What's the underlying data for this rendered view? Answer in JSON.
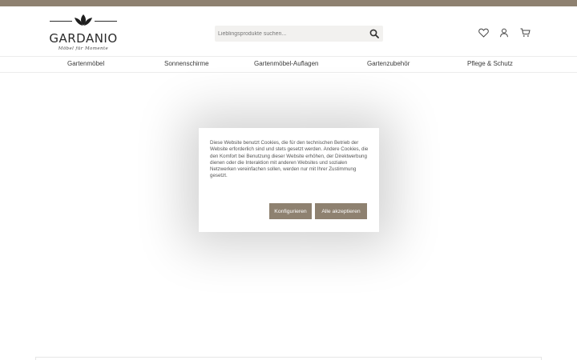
{
  "brand": {
    "name": "GARDANIO",
    "tagline": "Möbel für Momente",
    "accent_color": "#8e8170"
  },
  "search": {
    "placeholder": "Lieblingsprodukte suchen...",
    "icon": "search-icon"
  },
  "header_icons": [
    "heart-icon",
    "user-icon",
    "cart-icon"
  ],
  "nav": {
    "items": [
      {
        "label": "Gartenmöbel"
      },
      {
        "label": "Sonnenschirme"
      },
      {
        "label": "Gartenmöbel-Auflagen"
      },
      {
        "label": "Gartenzubehör"
      },
      {
        "label": "Pflege & Schutz"
      }
    ]
  },
  "cookie": {
    "text": "Diese Website benutzt Cookies, die für den technischen Betrieb der Website erforderlich sind und stets gesetzt werden. Andere Cookies, die den Komfort bei Benutzung dieser Website erhöhen, der Direktwerbung dienen oder die Interaktion mit anderen Websites und sozialen Netzwerken vereinfachen sollen, werden nur mit Ihrer Zustimmung gesetzt.",
    "configure_label": "Konfigurieren",
    "accept_label": "Alle akzeptieren"
  }
}
